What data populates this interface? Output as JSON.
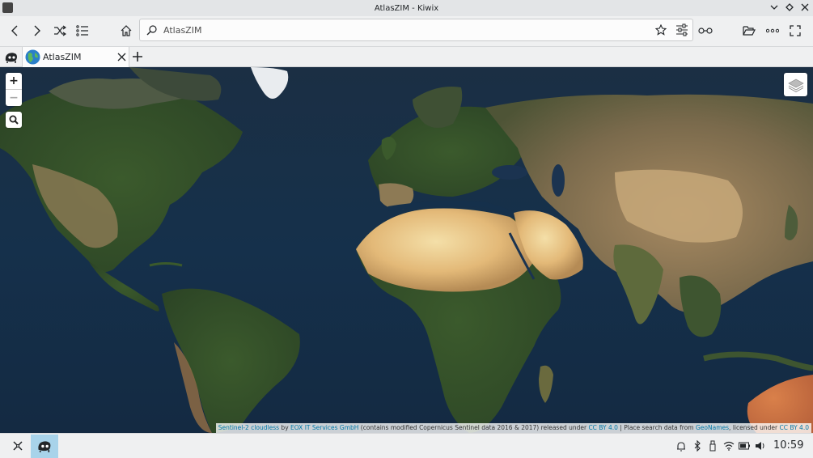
{
  "window": {
    "title": "AtlasZIM - Kiwix"
  },
  "toolbar": {
    "url_value": "AtlasZIM"
  },
  "tabs": [
    {
      "label": "AtlasZIM"
    }
  ],
  "map": {
    "zoom_in_label": "+",
    "zoom_out_label": "−",
    "attribution": {
      "link1": "Sentinel-2 cloudless",
      "text1": " by ",
      "link2": "EOX IT Services GmbH",
      "text2": " (contains modified Copernicus Sentinel data 2016 & 2017) released under ",
      "link3": "CC BY 4.0",
      "text3": " | Place search data from ",
      "link4": "GeoNames",
      "text4": ", licensed under ",
      "link5": "CC BY 4.0"
    }
  },
  "taskbar": {
    "clock": "10:59"
  },
  "colors": {
    "accent": "#3daee9",
    "ocean": "#14283e",
    "taskbar_active": "#a8d3ea"
  }
}
